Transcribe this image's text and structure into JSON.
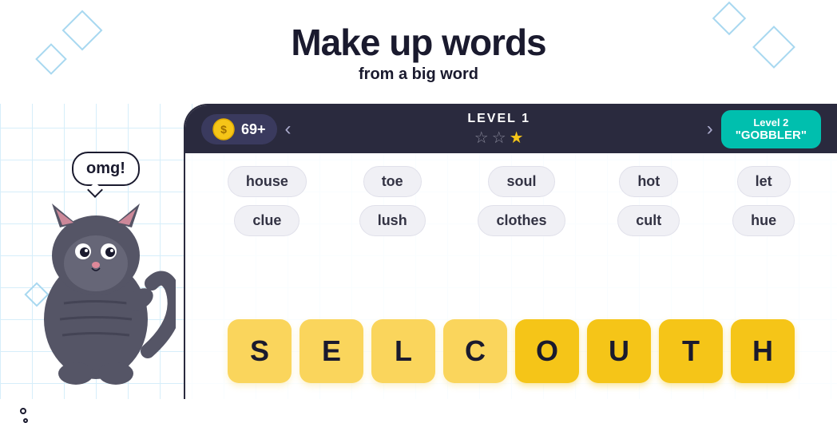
{
  "header": {
    "title": "Make up words",
    "subtitle": "from a big word"
  },
  "speech": {
    "text": "omg!"
  },
  "topbar": {
    "coins": "69+",
    "level_label": "LEVEL 1",
    "stars": [
      false,
      false,
      true
    ],
    "next_level_label": "Level 2",
    "next_level_name": "\"GOBBLER\""
  },
  "words": [
    {
      "text": "house",
      "col": 0,
      "row": 0
    },
    {
      "text": "clue",
      "col": 0,
      "row": 1
    },
    {
      "text": "toe",
      "col": 1,
      "row": 0
    },
    {
      "text": "lush",
      "col": 1,
      "row": 1
    },
    {
      "text": "soul",
      "col": 2,
      "row": 0
    },
    {
      "text": "clothes",
      "col": 2,
      "row": 1
    },
    {
      "text": "hot",
      "col": 3,
      "row": 0
    },
    {
      "text": "cult",
      "col": 3,
      "row": 1
    },
    {
      "text": "let",
      "col": 4,
      "row": 0
    },
    {
      "text": "hue",
      "col": 4,
      "row": 1
    }
  ],
  "letters": [
    {
      "char": "S",
      "style": "light-gold"
    },
    {
      "char": "E",
      "light-gold": true,
      "style": "light-gold"
    },
    {
      "char": "L",
      "style": "light-gold"
    },
    {
      "char": "C",
      "style": "light-gold"
    },
    {
      "char": "O",
      "style": "gold"
    },
    {
      "char": "U",
      "style": "gold"
    },
    {
      "char": "T",
      "style": "gold"
    },
    {
      "char": "H",
      "style": "gold"
    }
  ],
  "icons": {
    "coin": "💰",
    "star_empty": "☆",
    "star_filled": "★",
    "arrow_left": "‹",
    "arrow_right": "›"
  }
}
